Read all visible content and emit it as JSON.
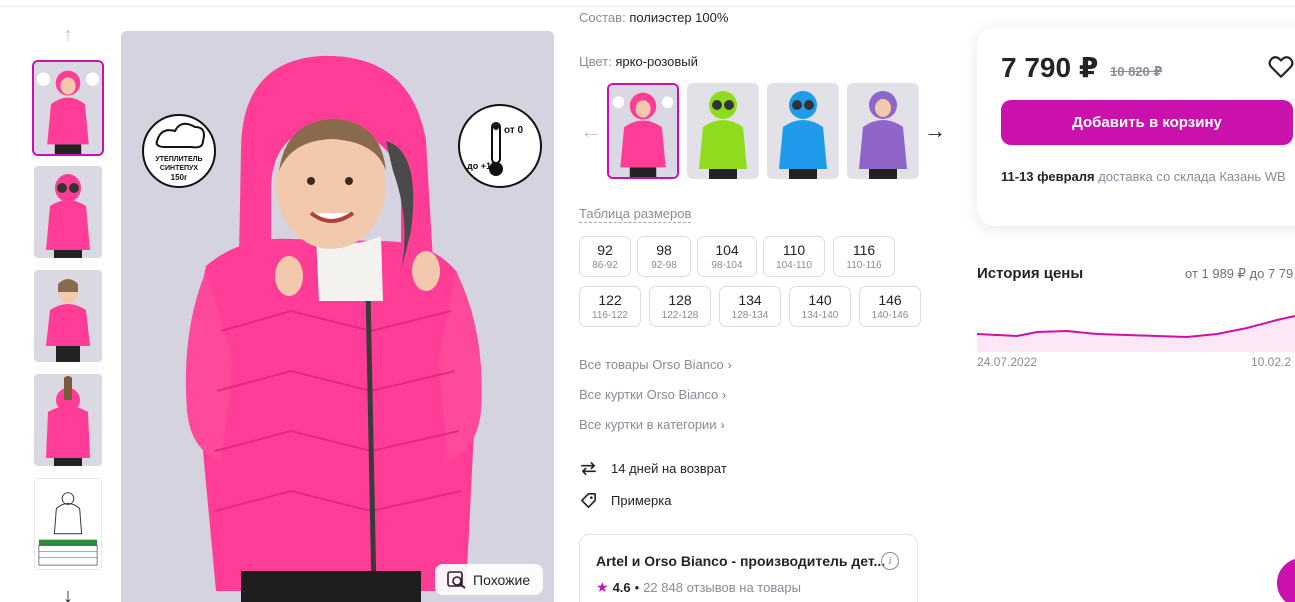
{
  "product": {
    "composition_label": "Состав:",
    "composition_value": "полиэстер 100%",
    "color_label": "Цвет:",
    "color_value": "ярко-розовый"
  },
  "photo_badges": {
    "insulation_line1": "УТЕПЛИТЕЛЬ",
    "insulation_line2": "СИНТЕПУХ",
    "insulation_line3": "150г",
    "temp_top": "от 0",
    "temp_bottom": "до +15"
  },
  "buttons": {
    "similar": "Похожие",
    "add_to_cart": "Добавить в корзину"
  },
  "colors": [
    "ярко-розовый",
    "салатовый",
    "голубой",
    "сиреневый"
  ],
  "size_table_link": "Таблица размеров",
  "sizes": [
    {
      "size": "92",
      "range": "86-92"
    },
    {
      "size": "98",
      "range": "92-98"
    },
    {
      "size": "104",
      "range": "98-104"
    },
    {
      "size": "110",
      "range": "104-110"
    },
    {
      "size": "116",
      "range": "110-116"
    },
    {
      "size": "122",
      "range": "116-122"
    },
    {
      "size": "128",
      "range": "122-128"
    },
    {
      "size": "134",
      "range": "128-134"
    },
    {
      "size": "140",
      "range": "134-140"
    },
    {
      "size": "146",
      "range": "140-146"
    }
  ],
  "links": [
    "Все товары Orso Bianco",
    "Все куртки Orso Bianco",
    "Все куртки в категории"
  ],
  "features": {
    "return": "14 дней на возврат",
    "fitting": "Примерка"
  },
  "seller": {
    "name": "Artel и Orso Bianco - производитель дет...",
    "rating": "4.6",
    "reviews": "22 848 отзывов на товары"
  },
  "price": {
    "current": "7 790 ₽",
    "old": "10 820 ₽"
  },
  "delivery": {
    "dates": "11-13 февраля",
    "text": "доставка со склада Казань WB"
  },
  "price_history": {
    "title": "История цены",
    "range": "от 1 989 ₽ до 7 79",
    "date_start": "24.07.2022",
    "date_end": "10.02.2"
  },
  "accent_color": "#cb11ab",
  "product_color": "#ff3d96"
}
